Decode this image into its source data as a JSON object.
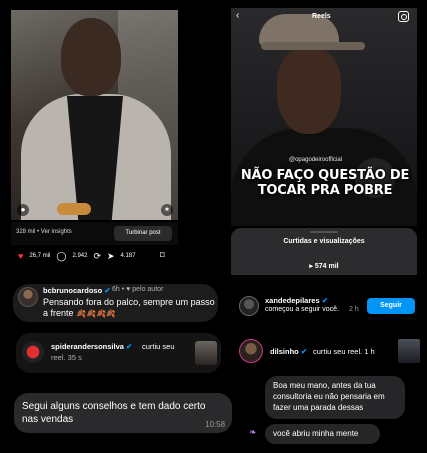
{
  "left_post": {
    "insights_text": "328 mil • Ver insights",
    "boost_label": "Turbinar post",
    "likes": "26,7 mil",
    "comments": "2.942",
    "shares": "4.187"
  },
  "right_reel": {
    "title": "Reels",
    "handle": "@opagodeiroofficial",
    "headline_line1": "NÃO FAÇO QUESTÃO DE",
    "headline_line2": "TOCAR PRA POBRE",
    "panel_title": "Curtidas e visualizações",
    "panel_count": "574 mil"
  },
  "comment": {
    "user": "bcbrunocardoso",
    "meta": "6h  •  ♥ pelo autor",
    "text": "Pensando fora do palco, sempre um passo a frente",
    "emoji": "🍂🍂🍂🍂"
  },
  "like_notification": {
    "user": "spiderandersonsilva",
    "action": "curtiu seu",
    "action2": "reel. 35 s"
  },
  "follow_notification": {
    "user": "xandedepilares",
    "action": "começou a seguir você.",
    "time": "2 h",
    "button_label": "Seguir"
  },
  "dil_notification": {
    "user": "dilsinho",
    "action": "curtiu seu reel. 1 h"
  },
  "chat_left": {
    "text": "Segui alguns conselhos e tem dado certo nas vendas",
    "time": "10:58"
  },
  "chat_right": {
    "message1": "Boa meu mano, antes da tua consultoria eu não pensaria em fazer uma parada dessas",
    "message2": "você abriu minha mente"
  },
  "colors": {
    "accent_blue": "#0095f6",
    "heart_red": "#ff3040"
  }
}
